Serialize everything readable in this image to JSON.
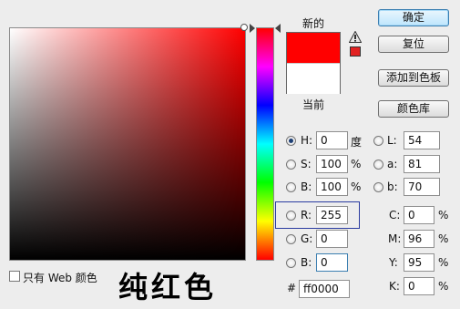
{
  "dialog": {
    "new_label": "新的",
    "current_label": "当前",
    "new_color": "#ff0000",
    "current_color": "#ffffff",
    "gamut_warning_color": "#e22222"
  },
  "buttons": {
    "ok": "确定",
    "reset": "复位",
    "add_to_swatches": "添加到色板",
    "color_libraries": "颜色库"
  },
  "hsb": {
    "h": {
      "label": "H:",
      "value": "0",
      "unit": "度"
    },
    "s": {
      "label": "S:",
      "value": "100",
      "unit": "%"
    },
    "b": {
      "label": "B:",
      "value": "100",
      "unit": "%"
    }
  },
  "rgb": {
    "r": {
      "label": "R:",
      "value": "255"
    },
    "g": {
      "label": "G:",
      "value": "0"
    },
    "b": {
      "label": "B:",
      "value": "0"
    }
  },
  "lab": {
    "l": {
      "label": "L:",
      "value": "54"
    },
    "a": {
      "label": "a:",
      "value": "81"
    },
    "b": {
      "label": "b:",
      "value": "70"
    }
  },
  "cmyk": {
    "c": {
      "label": "C:",
      "value": "0",
      "unit": "%"
    },
    "m": {
      "label": "M:",
      "value": "96",
      "unit": "%"
    },
    "y": {
      "label": "Y:",
      "value": "95",
      "unit": "%"
    },
    "k": {
      "label": "K:",
      "value": "0",
      "unit": "%"
    }
  },
  "hex": {
    "label": "#",
    "value": "ff0000"
  },
  "only_web": {
    "label": "只有 Web 颜色"
  },
  "overlay_caption": "纯红色"
}
